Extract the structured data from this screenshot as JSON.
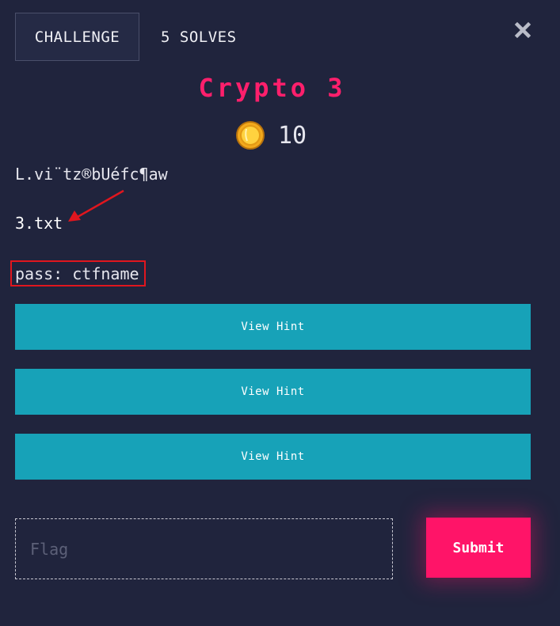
{
  "header": {
    "tab_challenge": "CHALLENGE",
    "tab_solves": "5 SOLVES",
    "close_icon": "close-icon"
  },
  "challenge": {
    "title": "Crypto 3",
    "points": "10",
    "coin_icon": "coin-icon",
    "cipher_text": "L.vi¨tz®bUéfc¶aw",
    "file_name": "3.txt",
    "pass_text": "pass: ctfname"
  },
  "hints": [
    {
      "label": "View Hint"
    },
    {
      "label": "View Hint"
    },
    {
      "label": "View Hint"
    }
  ],
  "form": {
    "flag_placeholder": "Flag",
    "flag_value": "",
    "submit_label": "Submit"
  },
  "colors": {
    "background": "#20243d",
    "title": "#ff1f6c",
    "hint_button": "#17a2b8",
    "submit_button": "#ff1468",
    "annotation_red": "#e0161e"
  }
}
